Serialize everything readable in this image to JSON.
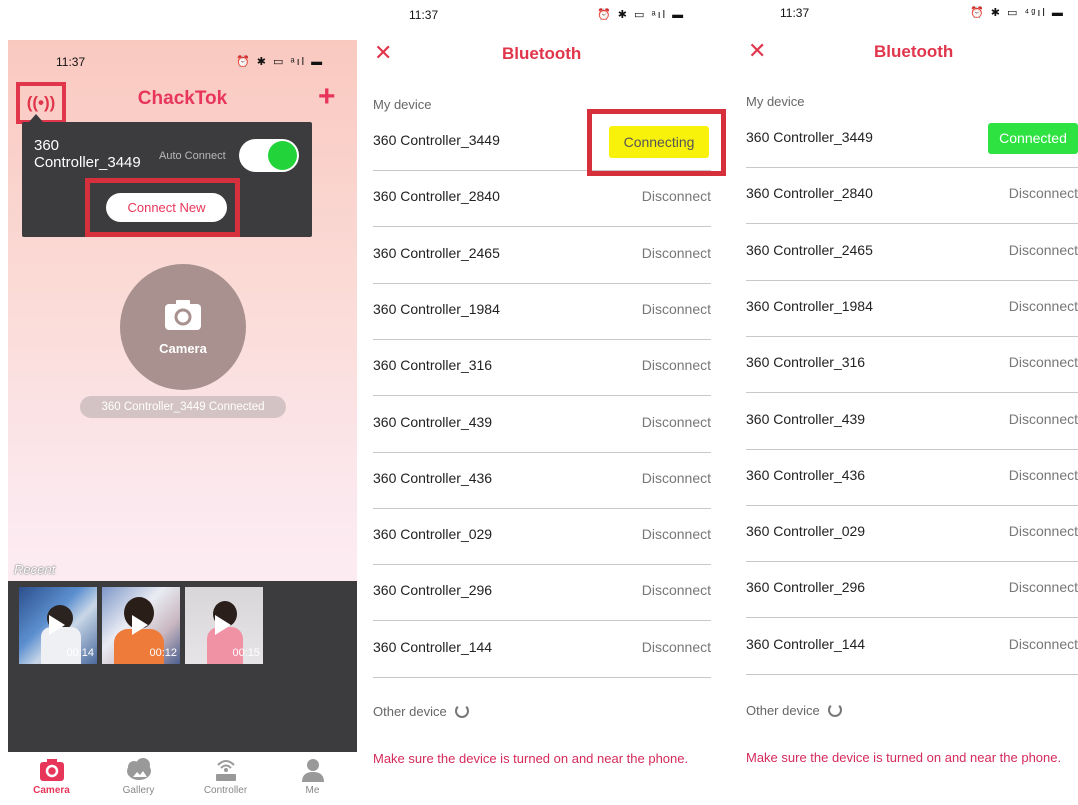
{
  "panel1": {
    "status_time": "11:37",
    "status_icons": "⏰ ✱ ▭ ᵃıl ▬",
    "connection_icon": "((•))",
    "app_title": "ChackTok",
    "add_icon": "+",
    "popup": {
      "device_name": "360\nController_3449",
      "auto_connect_label": "Auto Connect",
      "connect_new_label": "Connect New"
    },
    "camera_label": "Camera",
    "camera_status": "360 Controller_3449 Connected",
    "recent_label": "Recent",
    "thumbnails": [
      {
        "duration": "00:14"
      },
      {
        "duration": "00:12"
      },
      {
        "duration": "00:15"
      }
    ],
    "tabs": [
      {
        "label": "Camera",
        "icon": "camera-icon"
      },
      {
        "label": "Gallery",
        "icon": "cloud-icon"
      },
      {
        "label": "Controller",
        "icon": "wifi-router-icon"
      },
      {
        "label": "Me",
        "icon": "user-icon"
      }
    ],
    "colors": {
      "accent": "#e8365a",
      "popup_bg": "#3c3c3e",
      "toggle_on": "#22d33a"
    }
  },
  "panel2": {
    "status_time": "11:37",
    "status_icons": "⏰ ✱ ▭ ᵃıl ▬",
    "title": "Bluetooth",
    "my_device_label": "My device",
    "devices": [
      {
        "name": "360 Controller_3449",
        "status": "Connecting"
      },
      {
        "name": "360 Controller_2840",
        "status": "Disconnect"
      },
      {
        "name": "360 Controller_2465",
        "status": "Disconnect"
      },
      {
        "name": "360 Controller_1984",
        "status": "Disconnect"
      },
      {
        "name": "360 Controller_316",
        "status": "Disconnect"
      },
      {
        "name": "360 Controller_439",
        "status": "Disconnect"
      },
      {
        "name": "360 Controller_436",
        "status": "Disconnect"
      },
      {
        "name": "360 Controller_029",
        "status": "Disconnect"
      },
      {
        "name": "360 Controller_296",
        "status": "Disconnect"
      },
      {
        "name": "360 Controller_144",
        "status": "Disconnect"
      }
    ],
    "other_device_label": "Other device",
    "hint": "Make sure the device is turned on and near the phone.",
    "colors": {
      "connecting": "#f8f20a"
    }
  },
  "panel3": {
    "status_time": "11:37",
    "status_icons": "⏰ ✱ ▭ ⁴ᵍıl ▬",
    "title": "Bluetooth",
    "my_device_label": "My device",
    "devices": [
      {
        "name": "360 Controller_3449",
        "status": "Connected"
      },
      {
        "name": "360 Controller_2840",
        "status": "Disconnect"
      },
      {
        "name": "360 Controller_2465",
        "status": "Disconnect"
      },
      {
        "name": "360 Controller_1984",
        "status": "Disconnect"
      },
      {
        "name": "360 Controller_316",
        "status": "Disconnect"
      },
      {
        "name": "360 Controller_439",
        "status": "Disconnect"
      },
      {
        "name": "360 Controller_436",
        "status": "Disconnect"
      },
      {
        "name": "360 Controller_029",
        "status": "Disconnect"
      },
      {
        "name": "360 Controller_296",
        "status": "Disconnect"
      },
      {
        "name": "360 Controller_144",
        "status": "Disconnect"
      }
    ],
    "other_device_label": "Other device",
    "hint": "Make sure the device is turned on and near the phone.",
    "colors": {
      "connected": "#2ee242"
    }
  }
}
